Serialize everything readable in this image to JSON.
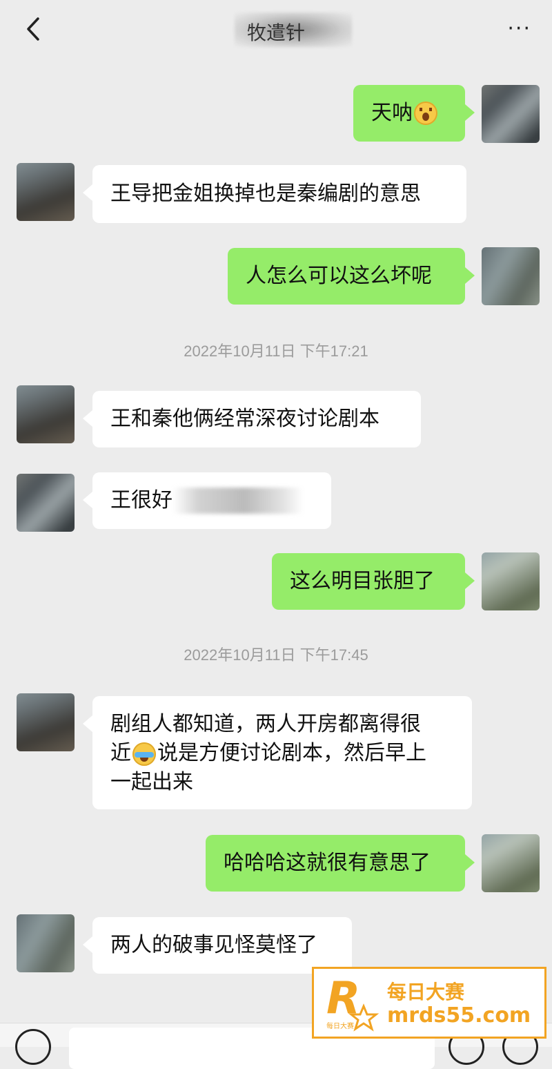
{
  "header": {
    "title": "牧遣针",
    "more_label": "···"
  },
  "messages": [
    {
      "side": "sent",
      "text": "天呐"
    },
    {
      "side": "recv",
      "text": "王导把金姐换掉也是秦编剧的意思"
    },
    {
      "side": "sent",
      "text": "人怎么可以这么坏呢"
    },
    {
      "side": "time",
      "text": "2022年10月11日 下午17:21"
    },
    {
      "side": "recv",
      "text": "王和秦他俩经常深夜讨论剧本"
    },
    {
      "side": "recv",
      "text": "王很好"
    },
    {
      "side": "sent",
      "text": "这么明目张胆了"
    },
    {
      "side": "time",
      "text": "2022年10月11日 下午17:45"
    },
    {
      "side": "recv",
      "lines": [
        "剧组人都知道，两人开房都离得很",
        "近",
        "说是方便讨论剧本，然后早上",
        "一起出来"
      ]
    },
    {
      "side": "sent",
      "text": "哈哈哈这就很有意思了"
    },
    {
      "side": "recv",
      "text": "两人的破事见怪莫怪了"
    }
  ],
  "watermark": {
    "name": "每日大赛",
    "url": "mrds55.com",
    "logo_small": "每日大赛",
    "color": "#f2a423"
  },
  "colors": {
    "background": "#ececec",
    "sent_bubble": "#95ec69",
    "recv_bubble": "#ffffff"
  }
}
